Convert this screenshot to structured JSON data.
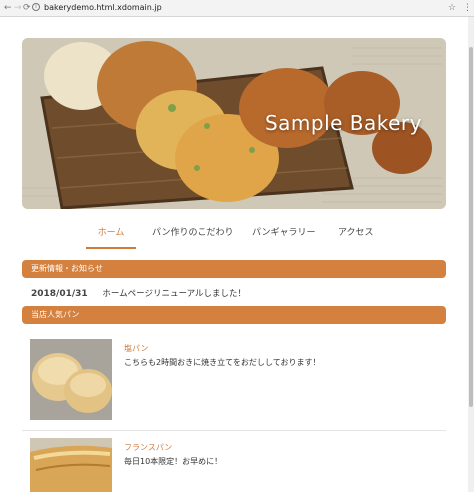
{
  "browser": {
    "back_icon": "←",
    "forward_icon": "→",
    "reload_icon": "⟳",
    "info_icon": "i",
    "url": "bakerydemo.html.xdomain.jp",
    "star_icon": "☆",
    "menu_icon": "⋮"
  },
  "hero": {
    "title": "Sample Bakery"
  },
  "nav": {
    "items": [
      {
        "label": "ホーム"
      },
      {
        "label": "パン作りのこだわり"
      },
      {
        "label": "パンギャラリー"
      },
      {
        "label": "アクセス"
      }
    ]
  },
  "news": {
    "heading": "更新情報・お知らせ",
    "entries": [
      {
        "date": "2018/01/31",
        "text": "ホームページリニューアルしました！"
      }
    ]
  },
  "popular": {
    "heading": "当店人気パン",
    "items": [
      {
        "name": "塩パン",
        "desc": "こちらも2時間おきに焼き立てをおだししております！"
      },
      {
        "name": "フランスパン",
        "desc": "毎日10本限定！お早めに！"
      }
    ]
  },
  "colors": {
    "accent": "#d4803f",
    "link": "#d07a3a"
  }
}
